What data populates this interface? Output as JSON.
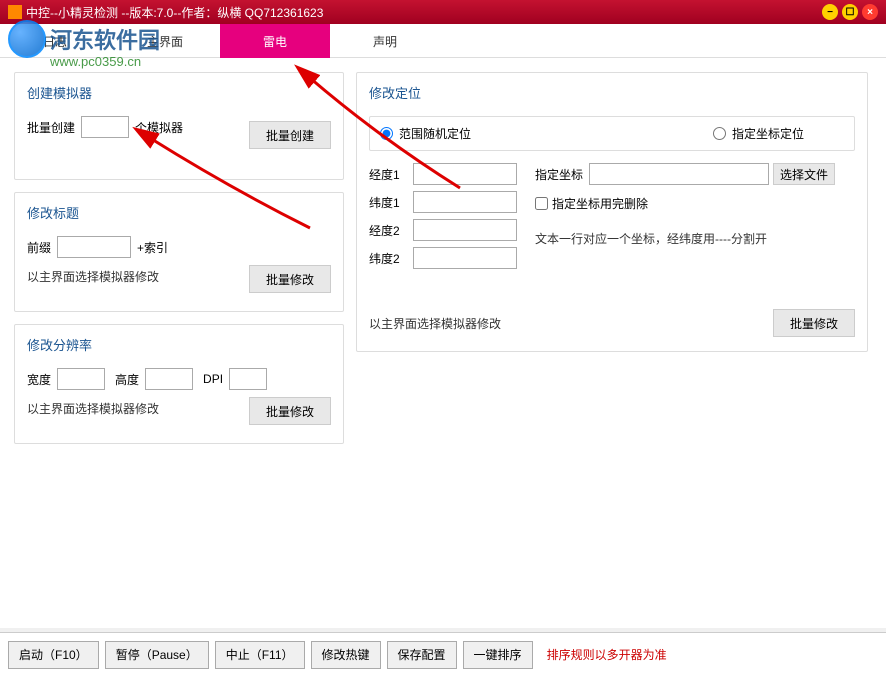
{
  "titlebar": {
    "text": "中控--小精灵检测 --版本:7.0--作者：纵横 QQ712361623"
  },
  "watermark": {
    "name": "河东软件园",
    "url": "www.pc0359.cn"
  },
  "menu": {
    "items": [
      "日志",
      "主界面",
      "雷电",
      "声明"
    ],
    "activeIndex": 2
  },
  "panels": {
    "createEmu": {
      "title": "创建模拟器",
      "batchLabel": "批量创建",
      "unitLabel": "个模拟器",
      "btnBatch": "批量创建"
    },
    "modTitle": {
      "title": "修改标题",
      "prefixLabel": "前缀",
      "suffixLabel": "+索引",
      "hint": "以主界面选择模拟器修改",
      "btn": "批量修改"
    },
    "modRes": {
      "title": "修改分辨率",
      "widthLabel": "宽度",
      "heightLabel": "高度",
      "dpiLabel": "DPI",
      "hint": "以主界面选择模拟器修改",
      "btn": "批量修改"
    },
    "modLoc": {
      "title": "修改定位",
      "radio1": "范围随机定位",
      "radio2": "指定坐标定位",
      "lng1": "经度1",
      "lat1": "纬度1",
      "lng2": "经度2",
      "lat2": "纬度2",
      "specLabel": "指定坐标",
      "chooseFile": "选择文件",
      "checkbox": "指定坐标用完删除",
      "fileHint": "文本一行对应一个坐标，经纬度用----分割开",
      "hint": "以主界面选择模拟器修改",
      "btn": "批量修改"
    }
  },
  "footer": {
    "btns": [
      "启动（F10）",
      "暂停（Pause）",
      "中止（F11）",
      "修改热键",
      "保存配置",
      "一键排序"
    ],
    "hint": "排序规则以多开器为准"
  }
}
